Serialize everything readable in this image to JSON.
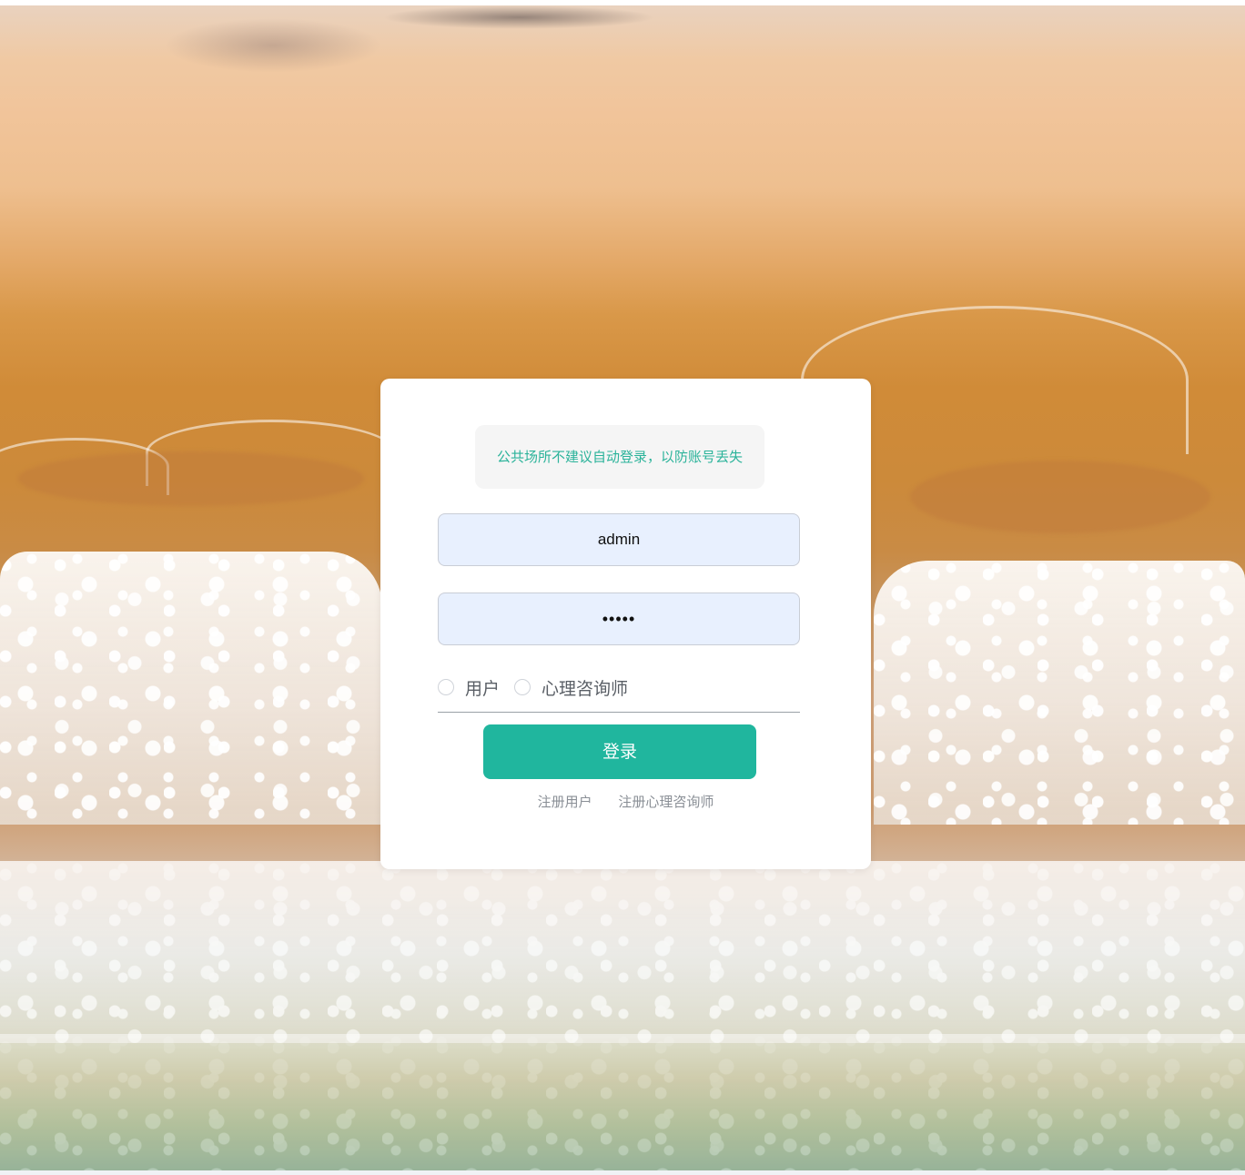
{
  "login": {
    "notice": "公共场所不建议自动登录，以防账号丢失",
    "username_value": "admin",
    "password_value": "•••••",
    "roles": [
      {
        "label": "用户",
        "selected": false
      },
      {
        "label": "心理咨询师",
        "selected": false
      }
    ],
    "login_button": "登录",
    "register_user_link": "注册用户",
    "register_counselor_link": "注册心理咨询师"
  },
  "colors": {
    "accent": "#20b69e",
    "notice_text": "#2bb39a",
    "input_background": "#e8f0fe"
  }
}
